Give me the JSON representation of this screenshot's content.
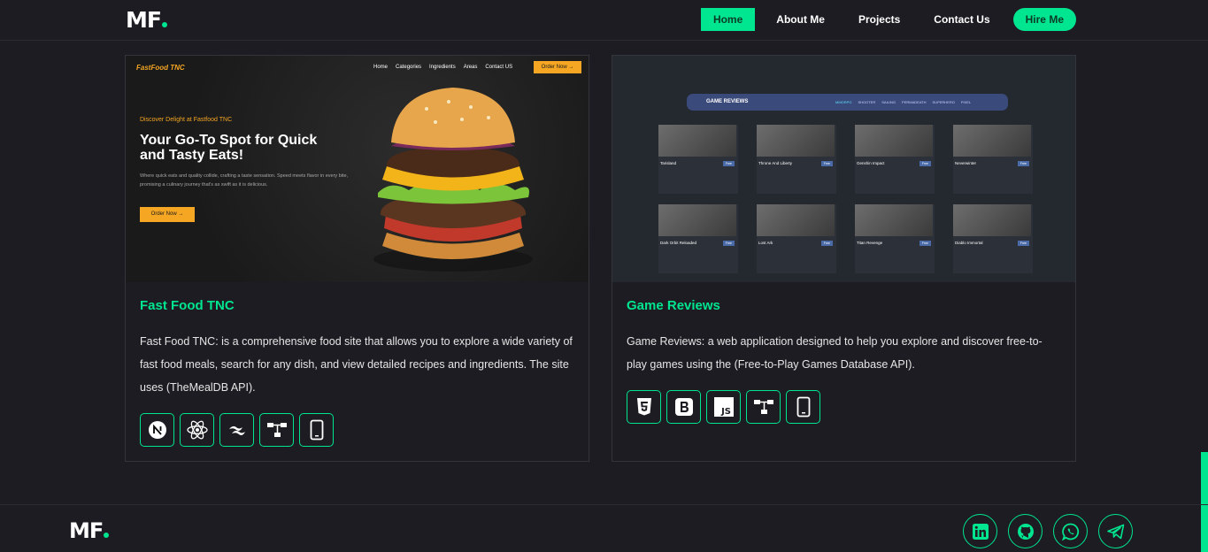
{
  "header": {
    "logo_text": "MF",
    "nav": [
      {
        "label": "Home",
        "active": true
      },
      {
        "label": "About Me"
      },
      {
        "label": "Projects"
      },
      {
        "label": "Contact Us"
      }
    ],
    "hire_label": "Hire Me"
  },
  "projects": [
    {
      "title": "Fast Food TNC",
      "description": "Fast Food TNC: is a comprehensive food site that allows you to explore a wide variety of fast food meals, search for any dish, and view detailed recipes and ingredients. The site uses (TheMealDB API).",
      "tech_icons": [
        "nextjs-icon",
        "react-icon",
        "tailwind-icon",
        "api-icon",
        "responsive-icon"
      ],
      "preview": {
        "logo": "FastFood TNC",
        "nav": [
          "Home",
          "Categories",
          "Ingredients",
          "Areas",
          "Contact US"
        ],
        "order_button": "Order Now →",
        "kicker": "Discover Delight at Fastfood TNC",
        "headline": "Your Go-To Spot for Quick and Tasty Eats!",
        "subtext": "Where quick eats and quality collide, crafting a taste sensation. Speed meets flavor in every bite, promising a culinary journey that's as swift as it is delicious.",
        "cta": "Order Now →"
      }
    },
    {
      "title": "Game Reviews",
      "description": "Game Reviews: a web application designed to help you explore and discover free-to-play games using the (Free-to-Play Games Database API).",
      "tech_icons": [
        "html5-icon",
        "bootstrap-icon",
        "javascript-icon",
        "api-icon",
        "responsive-icon"
      ],
      "preview": {
        "title": "GAME REVIEWS",
        "categories": [
          "MMORPG",
          "SHOOTER",
          "SAILING",
          "PERMADEATH",
          "SUPERHERO",
          "PIXEL"
        ],
        "games": [
          {
            "name": "Tarisland",
            "tag": "Free"
          },
          {
            "name": "Throne And Liberty",
            "tag": "Free"
          },
          {
            "name": "Genshin Impact",
            "tag": "Free"
          },
          {
            "name": "Neverwinter",
            "tag": "Free"
          },
          {
            "name": "Dark Orbit Reloaded",
            "tag": "Free"
          },
          {
            "name": "Lost Ark",
            "tag": "Free"
          },
          {
            "name": "Titan Revenge",
            "tag": "Free"
          },
          {
            "name": "Diablo Immortal",
            "tag": "Free"
          }
        ]
      }
    }
  ],
  "footer": {
    "logo_text": "MF",
    "socials": [
      "linkedin-icon",
      "github-icon",
      "whatsapp-icon",
      "telegram-icon"
    ]
  },
  "colors": {
    "accent": "#00e58f",
    "background": "#1c1c22",
    "food_accent": "#f5a623"
  }
}
